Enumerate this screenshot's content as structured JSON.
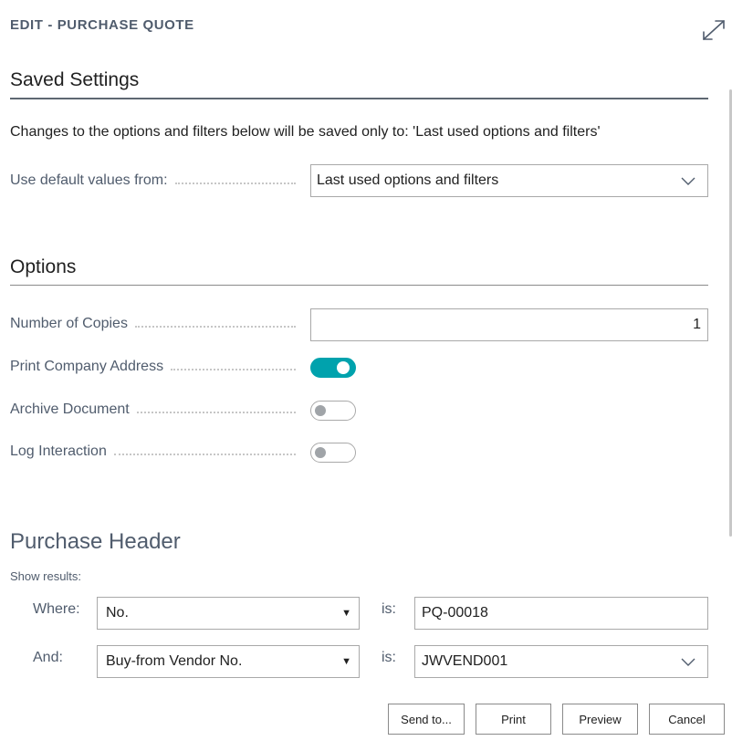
{
  "dialog": {
    "title": "EDIT - PURCHASE QUOTE"
  },
  "saved_settings": {
    "heading": "Saved Settings",
    "note": "Changes to the options and filters below will be saved only to: 'Last used options and filters'",
    "use_default_label": "Use default values from:",
    "use_default_value": "Last used options and filters"
  },
  "options": {
    "heading": "Options",
    "number_of_copies_label": "Number of Copies",
    "number_of_copies_value": "1",
    "print_company_address_label": "Print Company Address",
    "print_company_address_on": true,
    "archive_document_label": "Archive Document",
    "archive_document_on": false,
    "log_interaction_label": "Log Interaction",
    "log_interaction_on": false
  },
  "purchase_header": {
    "heading": "Purchase Header",
    "show_results": "Show results:",
    "filters": [
      {
        "connector": "Where:",
        "field": "No.",
        "is_label": "is:",
        "value": "PQ-00018"
      },
      {
        "connector": "And:",
        "field": "Buy-from Vendor No.",
        "is_label": "is:",
        "value": "JWVEND001"
      }
    ]
  },
  "buttons": {
    "send_to": "Send to...",
    "print": "Print",
    "preview": "Preview",
    "cancel": "Cancel"
  },
  "colors": {
    "accent": "#00a2ad",
    "label": "#505c6d",
    "border": "#a9a9a9"
  }
}
